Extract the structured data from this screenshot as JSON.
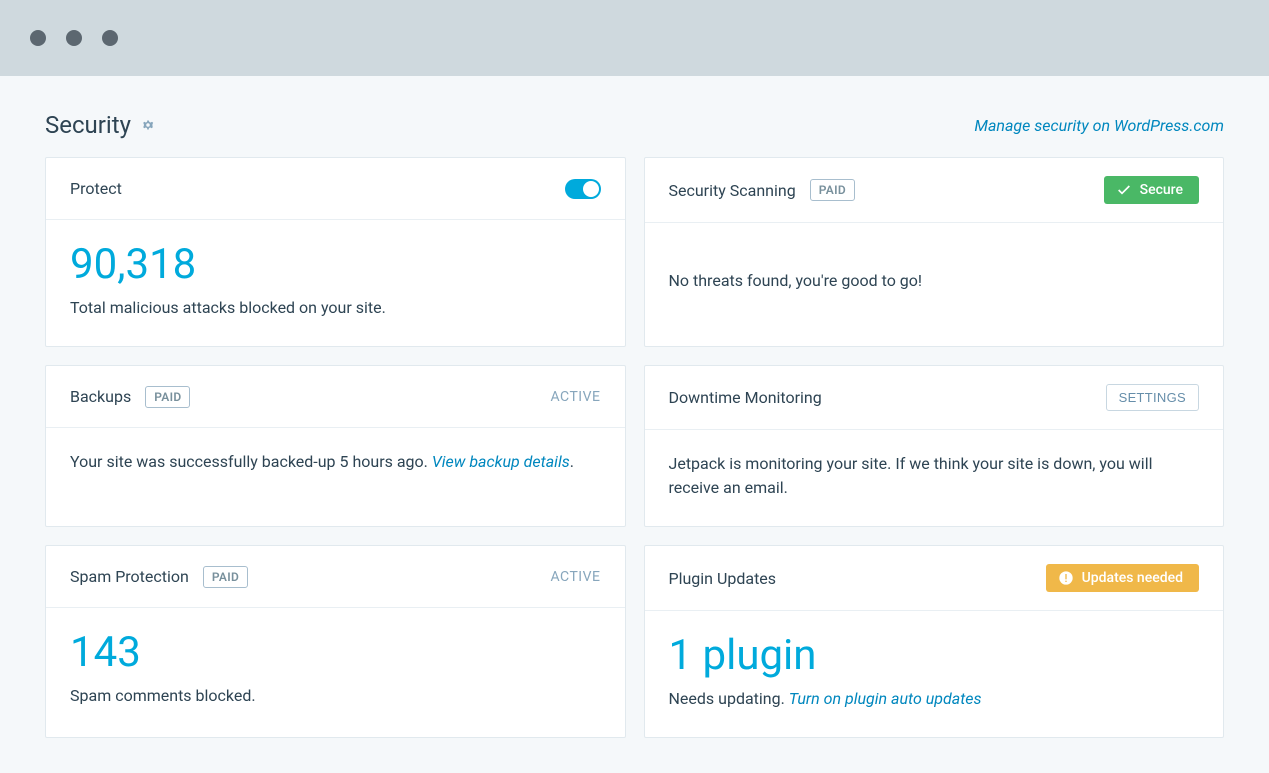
{
  "header": {
    "title": "Security",
    "manage_link": "Manage security on WordPress.com"
  },
  "cards": {
    "protect": {
      "title": "Protect",
      "count": "90,318",
      "desc": "Total malicious attacks blocked on your site."
    },
    "scanning": {
      "title": "Security Scanning",
      "paid": "PAID",
      "status": "Secure",
      "desc": "No threats found, you're good to go!"
    },
    "backups": {
      "title": "Backups",
      "paid": "PAID",
      "active": "ACTIVE",
      "desc_pre": "Your site was successfully backed-up 5 hours ago. ",
      "link": "View backup details",
      "desc_post": "."
    },
    "downtime": {
      "title": "Downtime Monitoring",
      "settings": "SETTINGS",
      "desc": "Jetpack is monitoring your site. If we think your site is down, you will receive an email."
    },
    "spam": {
      "title": "Spam Protection",
      "paid": "PAID",
      "active": "ACTIVE",
      "count": "143",
      "desc": "Spam comments blocked."
    },
    "plugins": {
      "title": "Plugin Updates",
      "status": "Updates needed",
      "count": "1 plugin",
      "desc_pre": "Needs updating. ",
      "link": "Turn on plugin auto updates"
    }
  }
}
